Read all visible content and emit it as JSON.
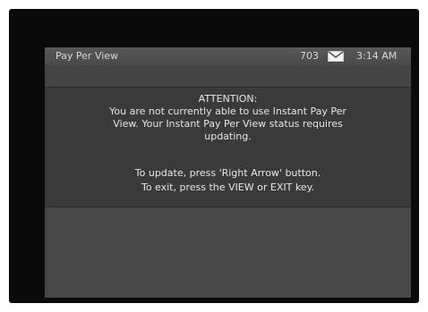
{
  "header": {
    "title": "Pay Per View",
    "channel": "703",
    "mail_icon": "mail-envelope-icon",
    "time": "3:14 AM"
  },
  "message": {
    "heading": "ATTENTION:",
    "body_lines": [
      "You are not currently able to use Instant Pay Per",
      "View. Your Instant Pay Per View status requires",
      "updating."
    ],
    "instructions": [
      "To update, press 'Right Arrow' button.",
      "To exit, press the VIEW or EXIT key."
    ]
  },
  "colors": {
    "screen_bg": "#0a0a0a",
    "panel_bg": "#444444",
    "header_bg": "#525252",
    "text": "#e6e6e6"
  }
}
